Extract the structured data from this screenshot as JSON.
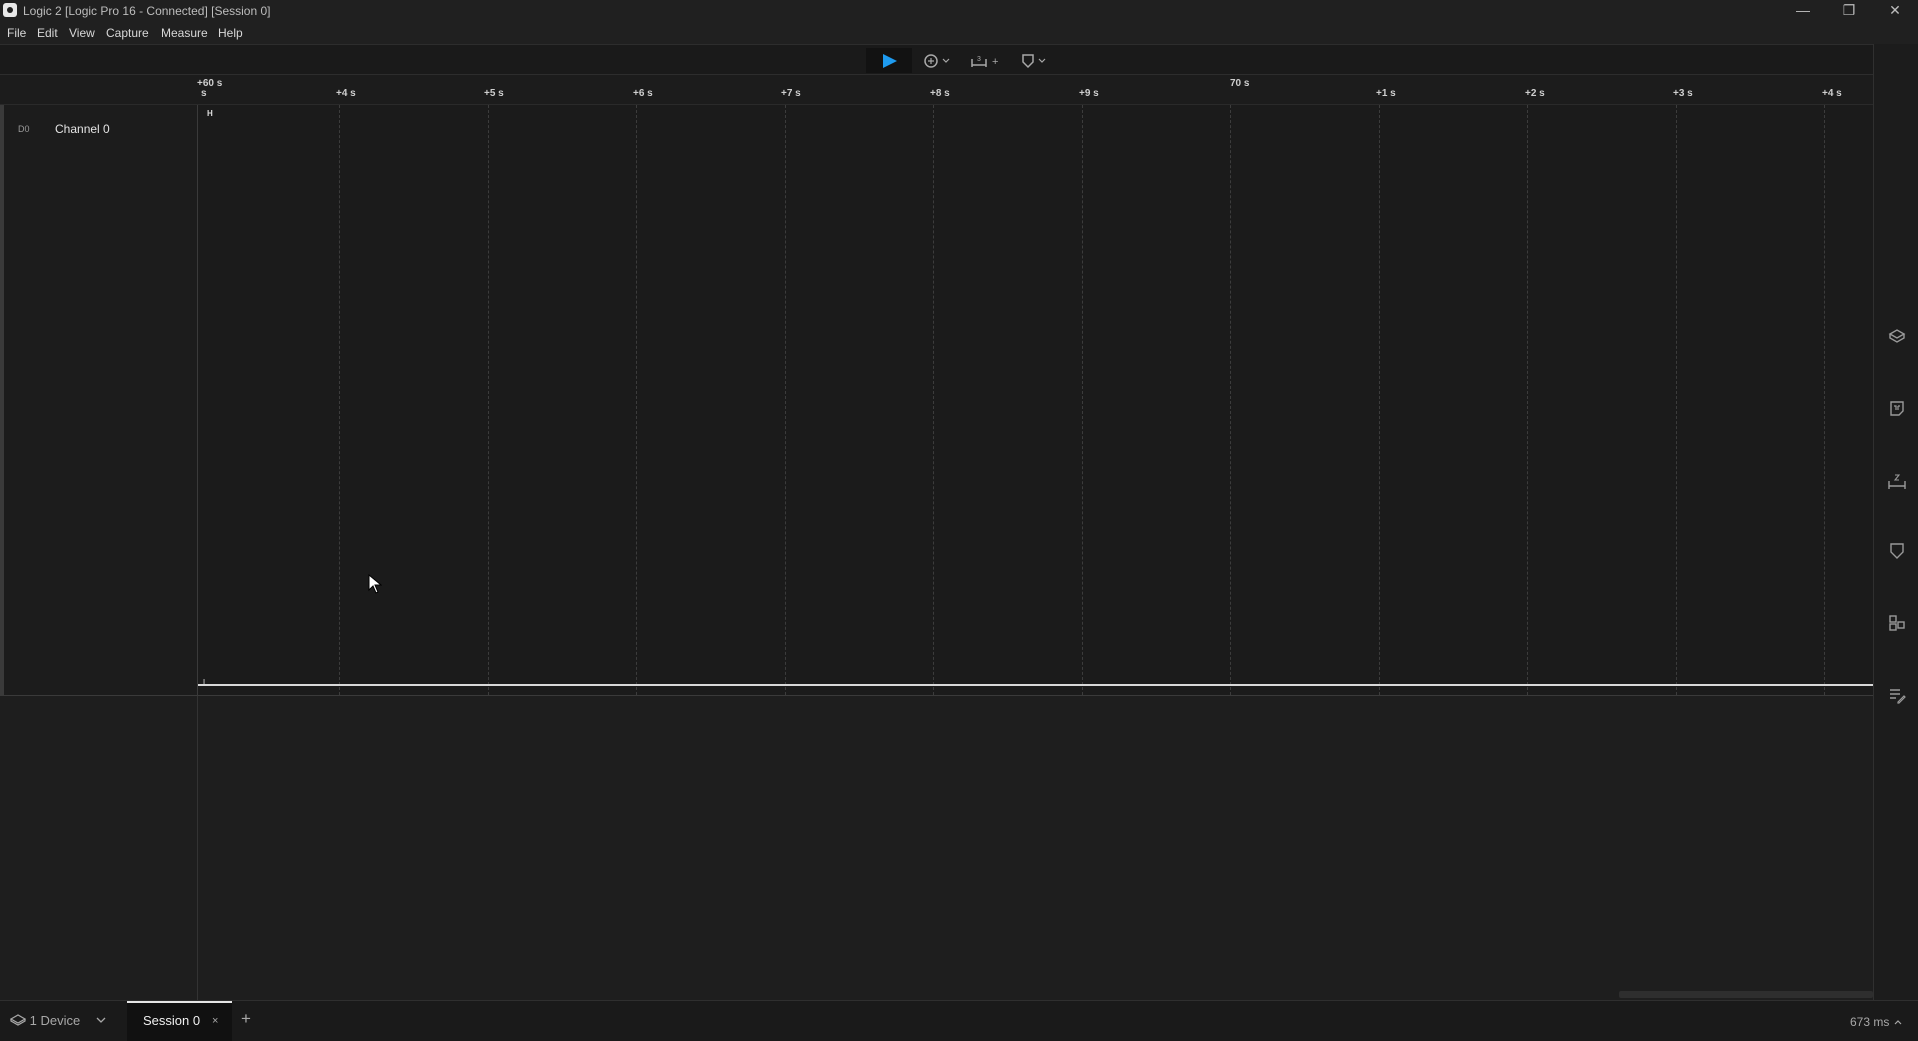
{
  "window": {
    "title": "Logic 2 [Logic Pro 16 - Connected] [Session 0]",
    "minimize": "—",
    "maximize": "❐",
    "close": "✕"
  },
  "menu": [
    "File",
    "Edit",
    "View",
    "Capture",
    "Measure",
    "Help"
  ],
  "toolbar": {
    "play_icon": "play-icon",
    "trigger_icon": "trigger-icon",
    "measure_icon": "measure-icon",
    "marker_icon": "marker-icon",
    "measure_add": "+"
  },
  "ruler": {
    "major_labels": [
      "+60 s",
      "70 s"
    ],
    "tick_labels": [
      "s",
      "+4 s",
      "+5 s",
      "+6 s",
      "+7 s",
      "+8 s",
      "+9 s",
      "+1 s",
      "+2 s",
      "+3 s",
      "+4 s"
    ]
  },
  "channels": [
    {
      "tag": "D0",
      "name": "Channel 0",
      "high_mark": "H",
      "low_mark": "L"
    }
  ],
  "sidebar_icons": [
    "device-icon",
    "analyzers-icon",
    "measurements-icon",
    "markers-icon",
    "extensions-icon",
    "notes-icon"
  ],
  "bottom": {
    "device": "1 Device",
    "session_tab": "Session 0",
    "session_close": "×",
    "add_tab": "+",
    "status": "673 ms"
  }
}
